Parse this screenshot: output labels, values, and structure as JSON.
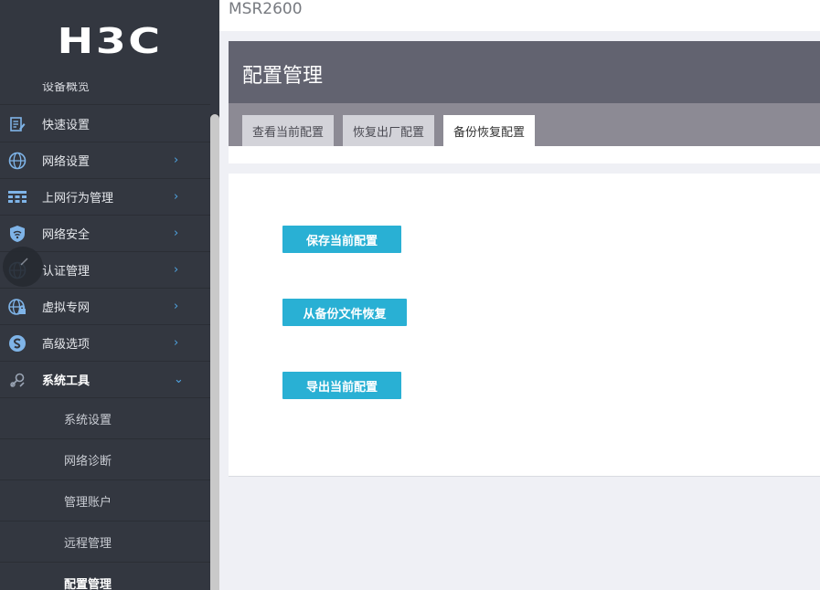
{
  "app": {
    "logo": "H3C",
    "product": "MSR2600"
  },
  "sidebar": {
    "partial_item": "设备概览",
    "items": [
      {
        "label": "快速设置",
        "icon": "quick-setup-icon",
        "has_arrow": false
      },
      {
        "label": "网络设置",
        "icon": "globe-icon",
        "has_arrow": true,
        "arrow": "›"
      },
      {
        "label": "上网行为管理",
        "icon": "behavior-grid-icon",
        "has_arrow": true,
        "arrow": "›"
      },
      {
        "label": "网络安全",
        "icon": "shield-wifi-icon",
        "has_arrow": true,
        "arrow": "›"
      },
      {
        "label": "认证管理",
        "icon": "auth-globe-icon",
        "has_arrow": true,
        "arrow": "›"
      },
      {
        "label": "虚拟专网",
        "icon": "vpn-globe-icon",
        "has_arrow": true,
        "arrow": "›"
      },
      {
        "label": "高级选项",
        "icon": "advanced-icon",
        "has_arrow": true,
        "arrow": "›"
      },
      {
        "label": "系统工具",
        "icon": "tools-icon",
        "has_arrow": true,
        "arrow": "⌄",
        "expanded": true
      }
    ],
    "sub_items": [
      {
        "label": "系统设置"
      },
      {
        "label": "网络诊断"
      },
      {
        "label": "管理账户"
      },
      {
        "label": "远程管理"
      },
      {
        "label": "配置管理",
        "active": true
      }
    ]
  },
  "panel": {
    "title": "配置管理",
    "tabs": [
      {
        "label": "查看当前配置"
      },
      {
        "label": "恢复出厂配置"
      },
      {
        "label": "备份恢复配置",
        "active": true
      }
    ]
  },
  "actions": {
    "save": "保存当前配置",
    "restore": "从备份文件恢复",
    "export": "导出当前配置"
  },
  "colors": {
    "sidebar": "#333740",
    "panel_header": "#626370",
    "tab_bar": "#8c8a94",
    "button": "#29b0d4",
    "arrow": "#4fa3e0"
  }
}
